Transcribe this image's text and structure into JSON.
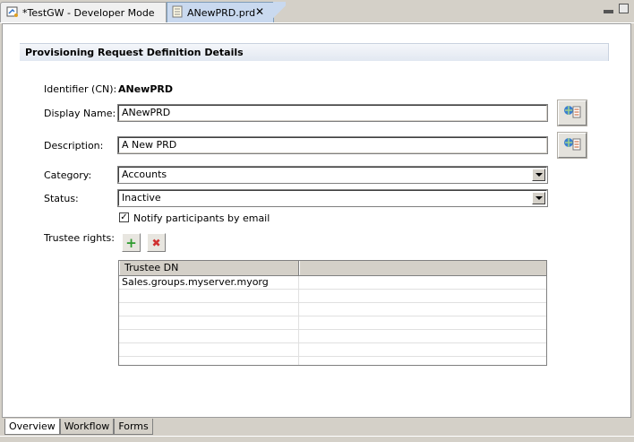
{
  "editor_tabs": [
    {
      "label": "*TestGW - Developer Mode",
      "active": false
    },
    {
      "label": "ANewPRD.prd",
      "active": true,
      "close": "✕"
    }
  ],
  "section": {
    "title": "Provisioning Request Definition Details"
  },
  "form": {
    "identifier_label": "Identifier (CN):",
    "identifier_value": "ANewPRD",
    "display_name_label": "Display Name:",
    "display_name_value": "ANewPRD",
    "description_label": "Description:",
    "description_value": "A New PRD",
    "category_label": "Category:",
    "category_value": "Accounts",
    "status_label": "Status:",
    "status_value": "Inactive",
    "notify_label": "Notify participants by email",
    "notify_checked": "✓",
    "trustee_label": "Trustee rights:",
    "add_glyph": "+",
    "remove_glyph": "✖"
  },
  "trustee_table": {
    "columns": [
      "Trustee DN",
      ""
    ],
    "rows": [
      [
        "Sales.groups.myserver.myorg",
        ""
      ],
      [
        "",
        ""
      ],
      [
        "",
        ""
      ],
      [
        "",
        ""
      ],
      [
        "",
        ""
      ],
      [
        "",
        ""
      ],
      [
        "",
        ""
      ]
    ]
  },
  "bottom_tabs": [
    {
      "label": "Overview",
      "active": true
    },
    {
      "label": "Workflow",
      "active": false
    },
    {
      "label": "Forms",
      "active": false
    }
  ],
  "icons": {
    "editor_tab_1": "developer-mode-icon",
    "editor_tab_2": "document-icon",
    "localize_button": "localize-icon",
    "add": "add-icon",
    "remove": "remove-icon"
  },
  "colors": {
    "active_tab": "#c9d9ef",
    "add_green": "#2e9b2e",
    "remove_red": "#d03030"
  }
}
